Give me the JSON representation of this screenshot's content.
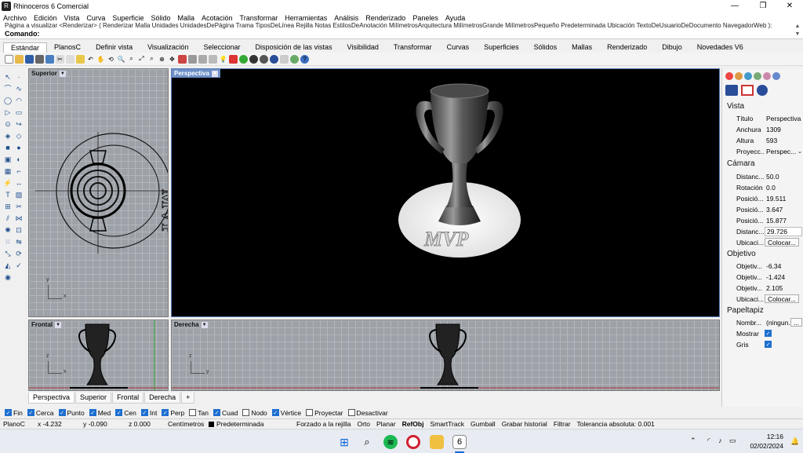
{
  "window": {
    "title": "Rhinoceros 6 Comercial",
    "app_icon": "rhino-icon"
  },
  "menu": [
    "Archivo",
    "Edición",
    "Vista",
    "Curva",
    "Superficie",
    "Sólido",
    "Malla",
    "Acotación",
    "Transformar",
    "Herramientas",
    "Análisis",
    "Renderizado",
    "Paneles",
    "Ayuda"
  ],
  "command_history": "Página a visualizar <Renderizar> ( Renderizar  Malla  Unidades  UnidadesDePágina  Trama  TiposDeLínea  Rejilla  Notas  EstilosDeAnotación  MilímetrosArquitectura  MilímetrosGrande  MilímetrosPequeño  Predeterminada  Ubicación  TextoDeUsuarioDeDocumento  NavegadorWeb ):",
  "command_prompt": "Comando:",
  "toolbar_tabs": [
    "Estándar",
    "PlanosC",
    "Definir vista",
    "Visualización",
    "Seleccionar",
    "Disposición de las vistas",
    "Visibilidad",
    "Transformar",
    "Curvas",
    "Superficies",
    "Sólidos",
    "Mallas",
    "Renderizado",
    "Dibujo",
    "Novedades V6"
  ],
  "active_toolbar_tab": "Estándar",
  "viewports": {
    "top": {
      "label": "Superior",
      "axis_y": "y",
      "axis_x": "x"
    },
    "perspective": {
      "label": "Perspectiva",
      "text": "MVP"
    },
    "front": {
      "label": "Frontal",
      "axis_y": "z",
      "axis_x": "x"
    },
    "right": {
      "label": "Derecha",
      "axis_y": "z",
      "axis_x": "y"
    }
  },
  "top_view_text": "MVP",
  "viewport_tabs": [
    "Perspectiva",
    "Superior",
    "Frontal",
    "Derecha"
  ],
  "add_tab_symbol": "+",
  "osnap": [
    {
      "label": "Fin",
      "checked": true
    },
    {
      "label": "Cerca",
      "checked": true
    },
    {
      "label": "Punto",
      "checked": true
    },
    {
      "label": "Med",
      "checked": true
    },
    {
      "label": "Cen",
      "checked": true
    },
    {
      "label": "Int",
      "checked": true
    },
    {
      "label": "Perp",
      "checked": true
    },
    {
      "label": "Tan",
      "checked": false
    },
    {
      "label": "Cuad",
      "checked": true
    },
    {
      "label": "Nodo",
      "checked": false
    },
    {
      "label": "Vértice",
      "checked": true
    },
    {
      "label": "Proyectar",
      "checked": false
    },
    {
      "label": "Desactivar",
      "checked": false
    }
  ],
  "status": {
    "cplane": "PlanoC",
    "x": "x -4.232",
    "y": "y -0.090",
    "z": "z 0.000",
    "units": "Centímetros",
    "layer": "Predeterminada",
    "grid_snap": "Forzado a la rejilla",
    "ortho": "Orto",
    "planar": "Planar",
    "refobj": "RefObj",
    "smarttrack": "SmartTrack",
    "gumball": "Gumball",
    "history": "Grabar historial",
    "filter": "Filtrar",
    "tolerance": "Tolerancia absoluta: 0.001"
  },
  "properties": {
    "vista_title": "Vista",
    "titulo_k": "Título",
    "titulo_v": "Perspectiva",
    "anchura_k": "Anchura",
    "anchura_v": "1309",
    "altura_k": "Altura",
    "altura_v": "593",
    "proyecc_k": "Proyecc...",
    "proyecc_v": "Perspec...",
    "camara_title": "Cámara",
    "distanc_k": "Distanc...",
    "distanc_v": "50.0",
    "rotacion_k": "Rotación",
    "rotacion_v": "0.0",
    "pos1_k": "Posició...",
    "pos1_v": "19.511",
    "pos2_k": "Posició...",
    "pos2_v": "3.647",
    "pos3_k": "Posició...",
    "pos3_v": "15.877",
    "distanc2_k": "Distanc...",
    "distanc2_v": "29.726",
    "ubicaci_k": "Ubicaci...",
    "colocar_label": "Colocar...",
    "objetivo_title": "Objetivo",
    "obj1_k": "Objetiv...",
    "obj1_v": "-6.34",
    "obj2_k": "Objetiv...",
    "obj2_v": "-1.424",
    "obj3_k": "Objetiv...",
    "obj3_v": "2.105",
    "ubicaci2_k": "Ubicaci...",
    "colocar2_label": "Colocar...",
    "papeltapiz_title": "Papeltapiz",
    "nombre_k": "Nombr...",
    "nombre_v": "(ningun...",
    "nombre_btn": "...",
    "mostrar_k": "Mostrar",
    "gris_k": "Gris"
  },
  "taskbar": {
    "time": "12:16",
    "date": "02/02/2024"
  }
}
